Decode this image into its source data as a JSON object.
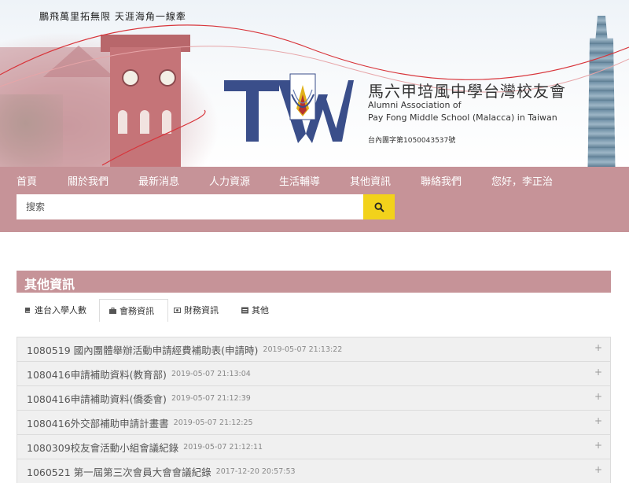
{
  "header": {
    "slogan": "鵬飛萬里拓無限  天涯海角一線牽",
    "org_name_zh": "馬六甲培風中學台灣校友會",
    "org_name_en_line1": "Alumni Association of",
    "org_name_en_line2": "Pay Fong Middle School (Malacca) in Taiwan",
    "registration": "台內團字第1050043537號",
    "logo_text": "TW"
  },
  "nav": {
    "items": [
      {
        "label": "首頁"
      },
      {
        "label": "關於我們"
      },
      {
        "label": "最新消息"
      },
      {
        "label": "人力資源"
      },
      {
        "label": "生活輔導"
      },
      {
        "label": "其他資訊"
      },
      {
        "label": "聯絡我們"
      },
      {
        "label": "您好，李正治"
      }
    ]
  },
  "search": {
    "placeholder": "搜索",
    "value": ""
  },
  "section": {
    "title": "其他資訊",
    "tabs": [
      {
        "label": "進台入學人數",
        "icon": "book-icon"
      },
      {
        "label": "會務資訊",
        "icon": "briefcase-icon"
      },
      {
        "label": "財務資訊",
        "icon": "money-icon"
      },
      {
        "label": "其他",
        "icon": "list-icon"
      }
    ],
    "active_tab": 1
  },
  "items": [
    {
      "title": "1080519 國內團體舉辦活動申請經費補助表(申請時)",
      "date": "2019-05-07 21:13:22"
    },
    {
      "title": "1080416申請補助資料(教育部)",
      "date": "2019-05-07 21:13:04"
    },
    {
      "title": "1080416申請補助資料(僑委會)",
      "date": "2019-05-07 21:12:39"
    },
    {
      "title": "1080416外交部補助申請計畫書",
      "date": "2019-05-07 21:12:25"
    },
    {
      "title": "1080309校友會活動小組會議紀錄",
      "date": "2019-05-07 21:12:11"
    },
    {
      "title": "1060521 第一屆第三次會員大會會議紀錄",
      "date": "2017-12-20 20:57:53"
    }
  ],
  "colors": {
    "nav_bg": "#c69398",
    "search_button": "#f2d21b",
    "logo_blue": "#3a4e8a"
  }
}
